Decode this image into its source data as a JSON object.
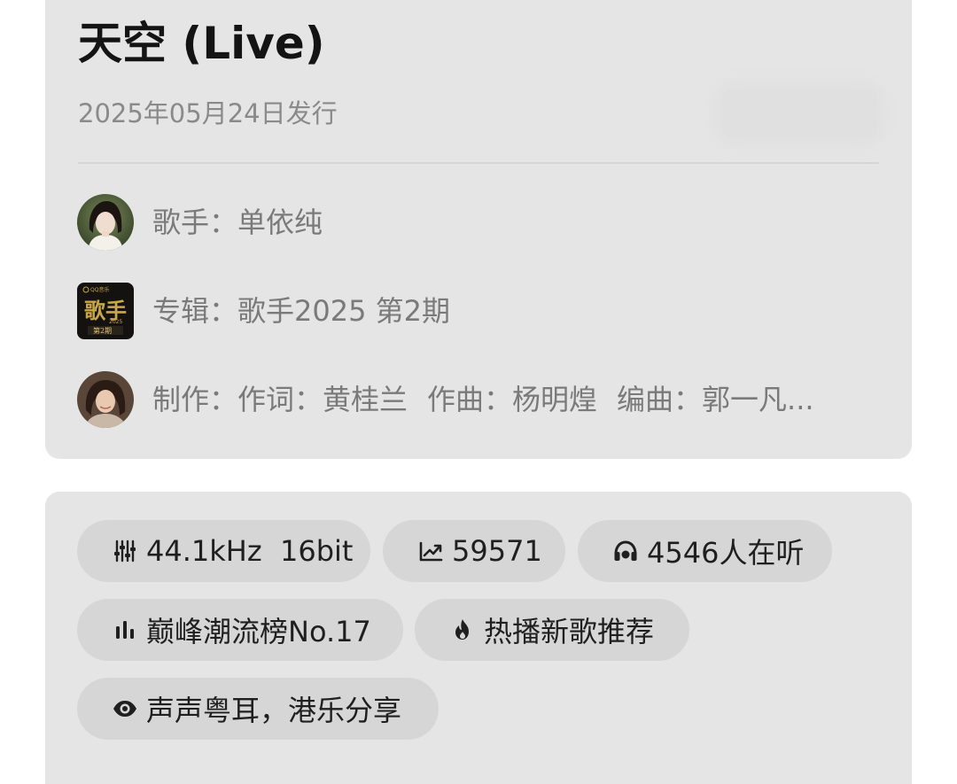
{
  "song": {
    "title": "天空 (Live)",
    "release_date": "2025年05月24日发行"
  },
  "meta": {
    "singer": {
      "key": "歌手：",
      "value": "单依纯",
      "icon": "singer-avatar"
    },
    "album": {
      "key": "专辑：",
      "value": "歌手2025 第2期",
      "icon": "album-cover",
      "cover_text": {
        "brand": "QQ音乐",
        "title": "歌手",
        "year": "2025",
        "issue": "第2期"
      }
    },
    "production": {
      "key": "制作：",
      "lyricist": "作词：黄桂兰",
      "composer": "作曲：杨明煌",
      "arranger": "编曲：郭一凡...",
      "icon": "producer-avatar"
    }
  },
  "tags": [
    {
      "icon": "equalizer-icon",
      "label": "44.1kHz  16bit"
    },
    {
      "icon": "trending-up-icon",
      "label": "59571"
    },
    {
      "icon": "headphones-icon",
      "label": "4546人在听"
    },
    {
      "icon": "chart-bars-icon",
      "label": "巅峰潮流榜No.17"
    },
    {
      "icon": "fire-icon",
      "label": "热播新歌推荐"
    },
    {
      "icon": "eye-icon",
      "label": "声声粤耳，港乐分享"
    }
  ],
  "colors": {
    "card_bg": "#e5e5e5",
    "chip_bg": "#d6d6d6",
    "title": "#141414",
    "secondary_text": "#7a7a7a"
  }
}
